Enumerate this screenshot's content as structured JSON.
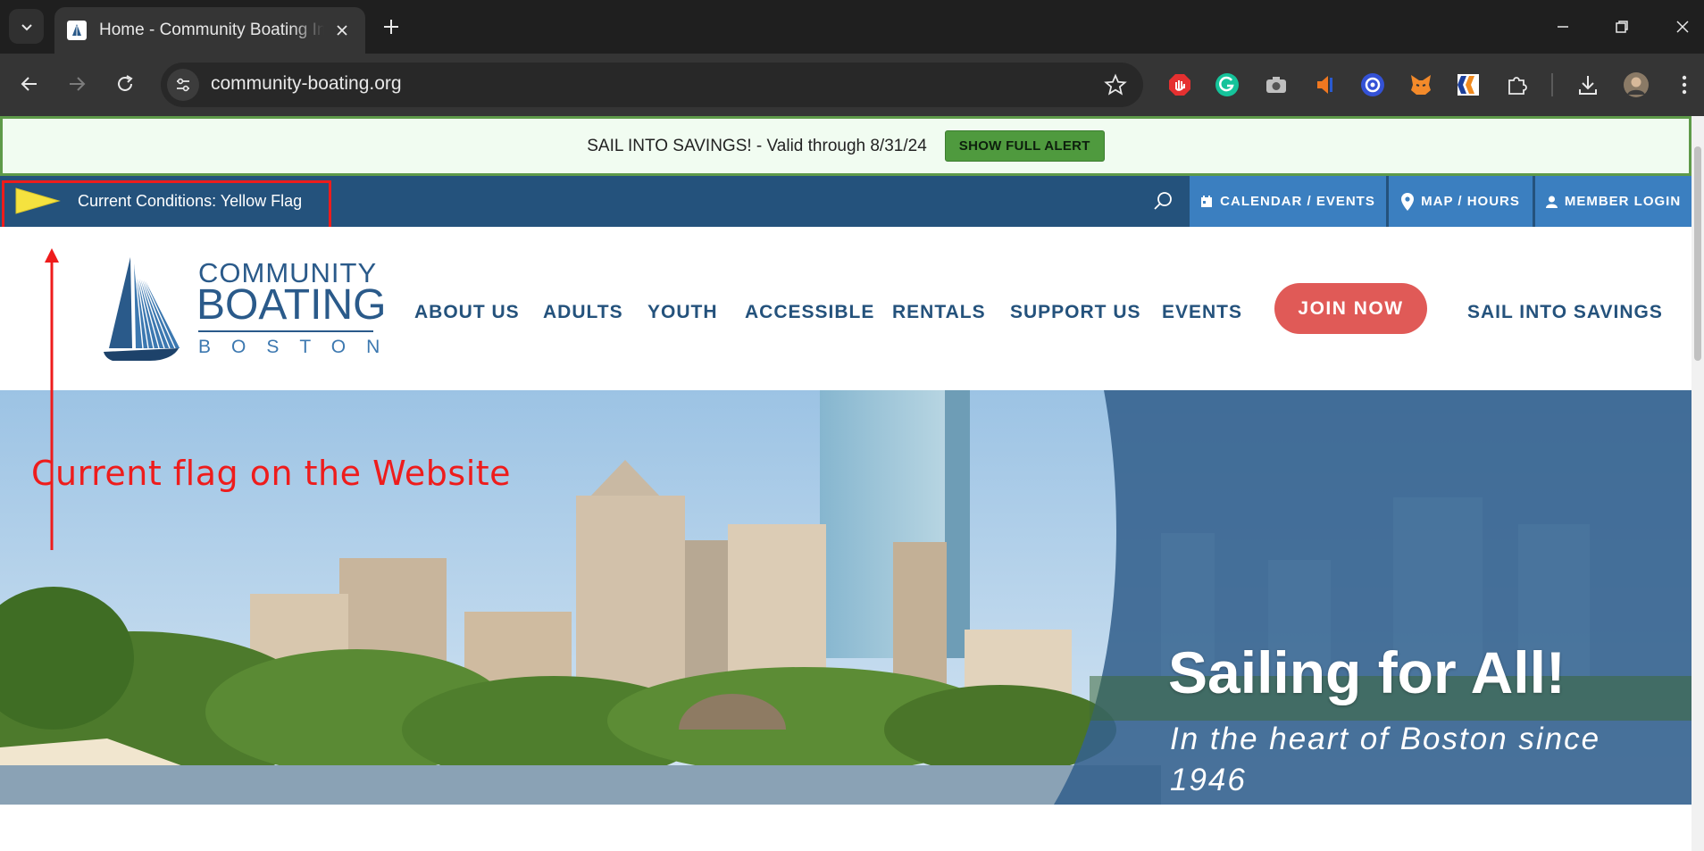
{
  "browser": {
    "tab_title": "Home - Community Boating Inc",
    "url": "community-boating.org",
    "icons": {
      "tab_search": "chevron-down-icon",
      "tab_close": "close-icon",
      "new_tab": "plus-icon",
      "minimize": "minimize-icon",
      "restore": "restore-icon",
      "close_window": "close-icon",
      "back": "arrow-left-icon",
      "forward": "arrow-right-icon",
      "reload": "reload-icon",
      "site_info": "tune-icon",
      "bookmark": "star-icon",
      "extensions": [
        "adblock-icon",
        "grammarly-icon",
        "camera-icon",
        "audio-icon",
        "target-icon",
        "metamask-icon",
        "k-logo-icon",
        "puzzle-icon"
      ],
      "download": "download-icon",
      "profile": "avatar",
      "menu": "more-vert-icon"
    }
  },
  "alert": {
    "text": "SAIL INTO SAVINGS! - Valid through 8/31/24",
    "button": "SHOW FULL ALERT"
  },
  "conditions": {
    "text": "Current Conditions: Yellow Flag",
    "flag_color": "#f5e23f"
  },
  "topnav": {
    "calendar": "CALENDAR / EVENTS",
    "map": "MAP / HOURS",
    "login": "MEMBER LOGIN"
  },
  "logo": {
    "line1": "COMMUNITY",
    "line2": "BOATING",
    "line3": "BOSTON"
  },
  "menu": {
    "about": "ABOUT US",
    "adults": "ADULTS",
    "youth": "YOUTH",
    "accessible": "ACCESSIBLE",
    "rentals": "RENTALS",
    "support": "SUPPORT US",
    "events": "EVENTS",
    "join": "JOIN NOW",
    "sail": "SAIL INTO SAVINGS"
  },
  "hero": {
    "title": "Sailing for All!",
    "subtitle": "In the heart of Boston since 1946"
  },
  "annotation": {
    "text": "Current flag on the Website"
  },
  "colors": {
    "brand_blue": "#24527c",
    "nav_light_blue": "#3b7fc0",
    "join_red": "#e05a57",
    "alert_green": "#4f9a3e",
    "annotation_red": "#ee1c1c"
  }
}
